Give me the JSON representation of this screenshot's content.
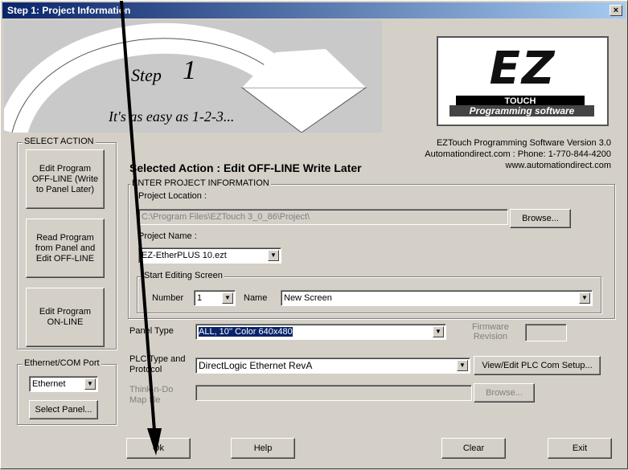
{
  "window": {
    "title": "Step 1: Project Information",
    "close_label": "×"
  },
  "banner": {
    "step_word": "Step",
    "step_number": "1",
    "tagline": "It's as easy as 1-2-3..."
  },
  "logo": {
    "main": "EZ",
    "sub": "TOUCH",
    "prog": "Programming software"
  },
  "version_info": {
    "line1": "EZTouch Programming Software Version 3.0",
    "line2": "Automationdirect.com : Phone: 1-770-844-4200",
    "line3": "www.automationdirect.com"
  },
  "select_action": {
    "title": "SELECT ACTION",
    "buttons": [
      "Edit Program\nOFF-LINE (Write\nto Panel Later)",
      "Read Program\nfrom Panel and\nEdit OFF-LINE",
      "Edit Program\nON-LINE"
    ]
  },
  "port": {
    "title": "Ethernet/COM Port",
    "value": "Ethernet",
    "select_panel_label": "Select Panel..."
  },
  "selected_action": "Selected  Action : Edit OFF-LINE Write Later",
  "project_info": {
    "title": "ENTER PROJECT INFORMATION",
    "location_label": "Project Location :",
    "location_value": "C:\\Program Files\\EZTouch 3_0_86\\Project\\",
    "browse_label": "Browse...",
    "name_label": "Project Name :",
    "name_value": "EZ-EtherPLUS 10.ezt",
    "start_screen": {
      "title": "Start Editing Screen",
      "number_label": "Number",
      "number_value": "1",
      "name_label": "Name",
      "name_value": "New Screen"
    }
  },
  "panel": {
    "label": "Panel Type",
    "value": "ALL, 10'' Color 640x480",
    "firmware_label": "Firmware\nRevision",
    "firmware_value": ""
  },
  "plc": {
    "label": "PLC Type and\nProtocol",
    "value": "DirectLogic Ethernet RevA",
    "setup_label": "View/Edit PLC Com Setup..."
  },
  "thinkndo": {
    "label": "Think-n-Do\nMap file",
    "value": "",
    "browse_label": "Browse..."
  },
  "footer": {
    "ok": "Ok",
    "help": "Help",
    "clear": "Clear",
    "exit": "Exit"
  }
}
